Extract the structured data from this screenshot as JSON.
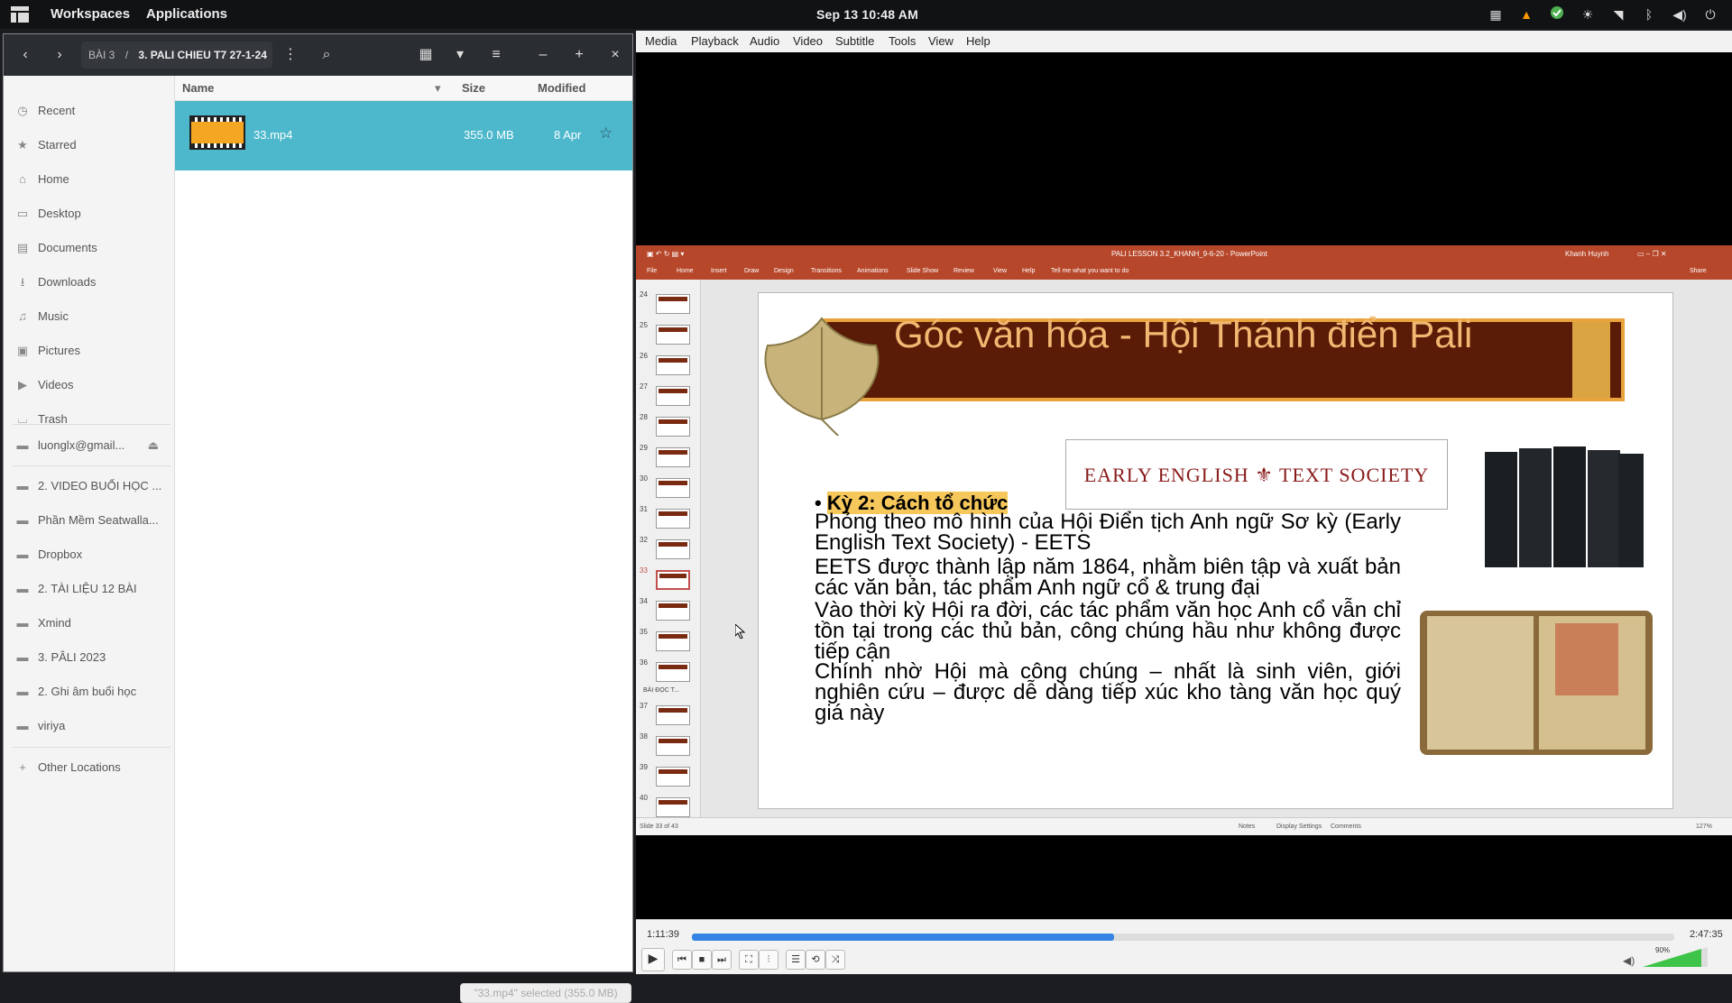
{
  "topbar": {
    "workspaces": "Workspaces",
    "applications": "Applications",
    "clock": "Sep 13  10:48 AM",
    "tray_icons": [
      "workspace-switch-icon",
      "vlc-cone-icon",
      "update-check-icon",
      "brightness-icon",
      "wifi-icon",
      "bluetooth-icon",
      "volume-icon",
      "power-icon"
    ]
  },
  "files": {
    "breadcrumb_parent": "BÀI 3",
    "breadcrumb_sep": "/",
    "breadcrumb_current": "3. PALI CHIEU T7 27-1-24",
    "sidebar": [
      {
        "label": "Recent",
        "icon": "clock-icon"
      },
      {
        "label": "Starred",
        "icon": "star-icon"
      },
      {
        "label": "Home",
        "icon": "home-icon"
      },
      {
        "label": "Desktop",
        "icon": "desktop-icon"
      },
      {
        "label": "Documents",
        "icon": "document-icon"
      },
      {
        "label": "Downloads",
        "icon": "download-icon"
      },
      {
        "label": "Music",
        "icon": "music-icon"
      },
      {
        "label": "Pictures",
        "icon": "picture-icon"
      },
      {
        "label": "Videos",
        "icon": "video-icon"
      },
      {
        "label": "Trash",
        "icon": "trash-icon"
      }
    ],
    "drive": "luonglx@gmail...",
    "bookmarks": [
      "2.  VIDEO BUỔI HỌC ...",
      "Phần Mềm Seatwalla...",
      "Dropbox",
      "2. TÀI LIỆU 12 BÀI",
      "Xmind",
      "3. PÂLI 2023",
      "2. Ghi âm buổi học",
      "viriya"
    ],
    "other_locations": "Other Locations",
    "columns": {
      "name": "Name",
      "size": "Size",
      "modified": "Modified"
    },
    "file": {
      "name": "33.mp4",
      "size": "355.0 MB",
      "modified": "8 Apr"
    },
    "status": "\"33.mp4\" selected (355.0 MB)"
  },
  "vlc": {
    "menu": [
      "Media",
      "Playback",
      "Audio",
      "Video",
      "Subtitle",
      "Tools",
      "View",
      "Help"
    ],
    "elapsed": "1:11:39",
    "total": "2:47:35",
    "progress": 0.43,
    "volume": "90%"
  },
  "ppt": {
    "window_title": "PALI LESSON 3.2_KHANH_9-6-20  -  PowerPoint",
    "user": "Khanh Huynh",
    "ribbon_tabs": [
      "File",
      "Home",
      "Insert",
      "Draw",
      "Design",
      "Transitions",
      "Animations",
      "Slide Show",
      "Review",
      "View",
      "Help"
    ],
    "tell_me": "Tell me what you want to do",
    "share": "Share",
    "thumb_numbers": [
      "24",
      "25",
      "26",
      "27",
      "28",
      "29",
      "30",
      "31",
      "32",
      "33",
      "34",
      "35",
      "36",
      "37",
      "38",
      "39",
      "40"
    ],
    "section_label": "BÀI ĐỌC T...",
    "slide_status": "Slide 33 of 43",
    "notes": "Notes",
    "display_settings": "Display Settings",
    "comments": "Comments",
    "zoom": "127%"
  },
  "slide": {
    "title": "Góc văn hóa - Hội Thánh điển Pali",
    "logo_text": "EARLY ENGLISH  TEXT SOCIETY",
    "bullet": "Kỳ 2: Cách tổ chức",
    "paragraphs": [
      "Phỏng theo mô hình của Hội Điển tịch Anh ngữ Sơ kỳ (Early English Text Society) - EETS",
      "EETS được thành lập năm 1864, nhằm biên tập và xuất bản các văn bản, tác phẩm Anh ngữ cổ & trung đại",
      "Vào thời kỳ Hội ra đời, các tác phẩm văn học Anh cổ vẫn chỉ tồn tại trong các thủ bản, công chúng hầu như không được tiếp cận",
      "Chính nhờ Hội mà công chúng – nhất là sinh viên, giới nghiên cứu – được dễ dàng tiếp xúc kho tàng văn học quý giá này"
    ]
  }
}
